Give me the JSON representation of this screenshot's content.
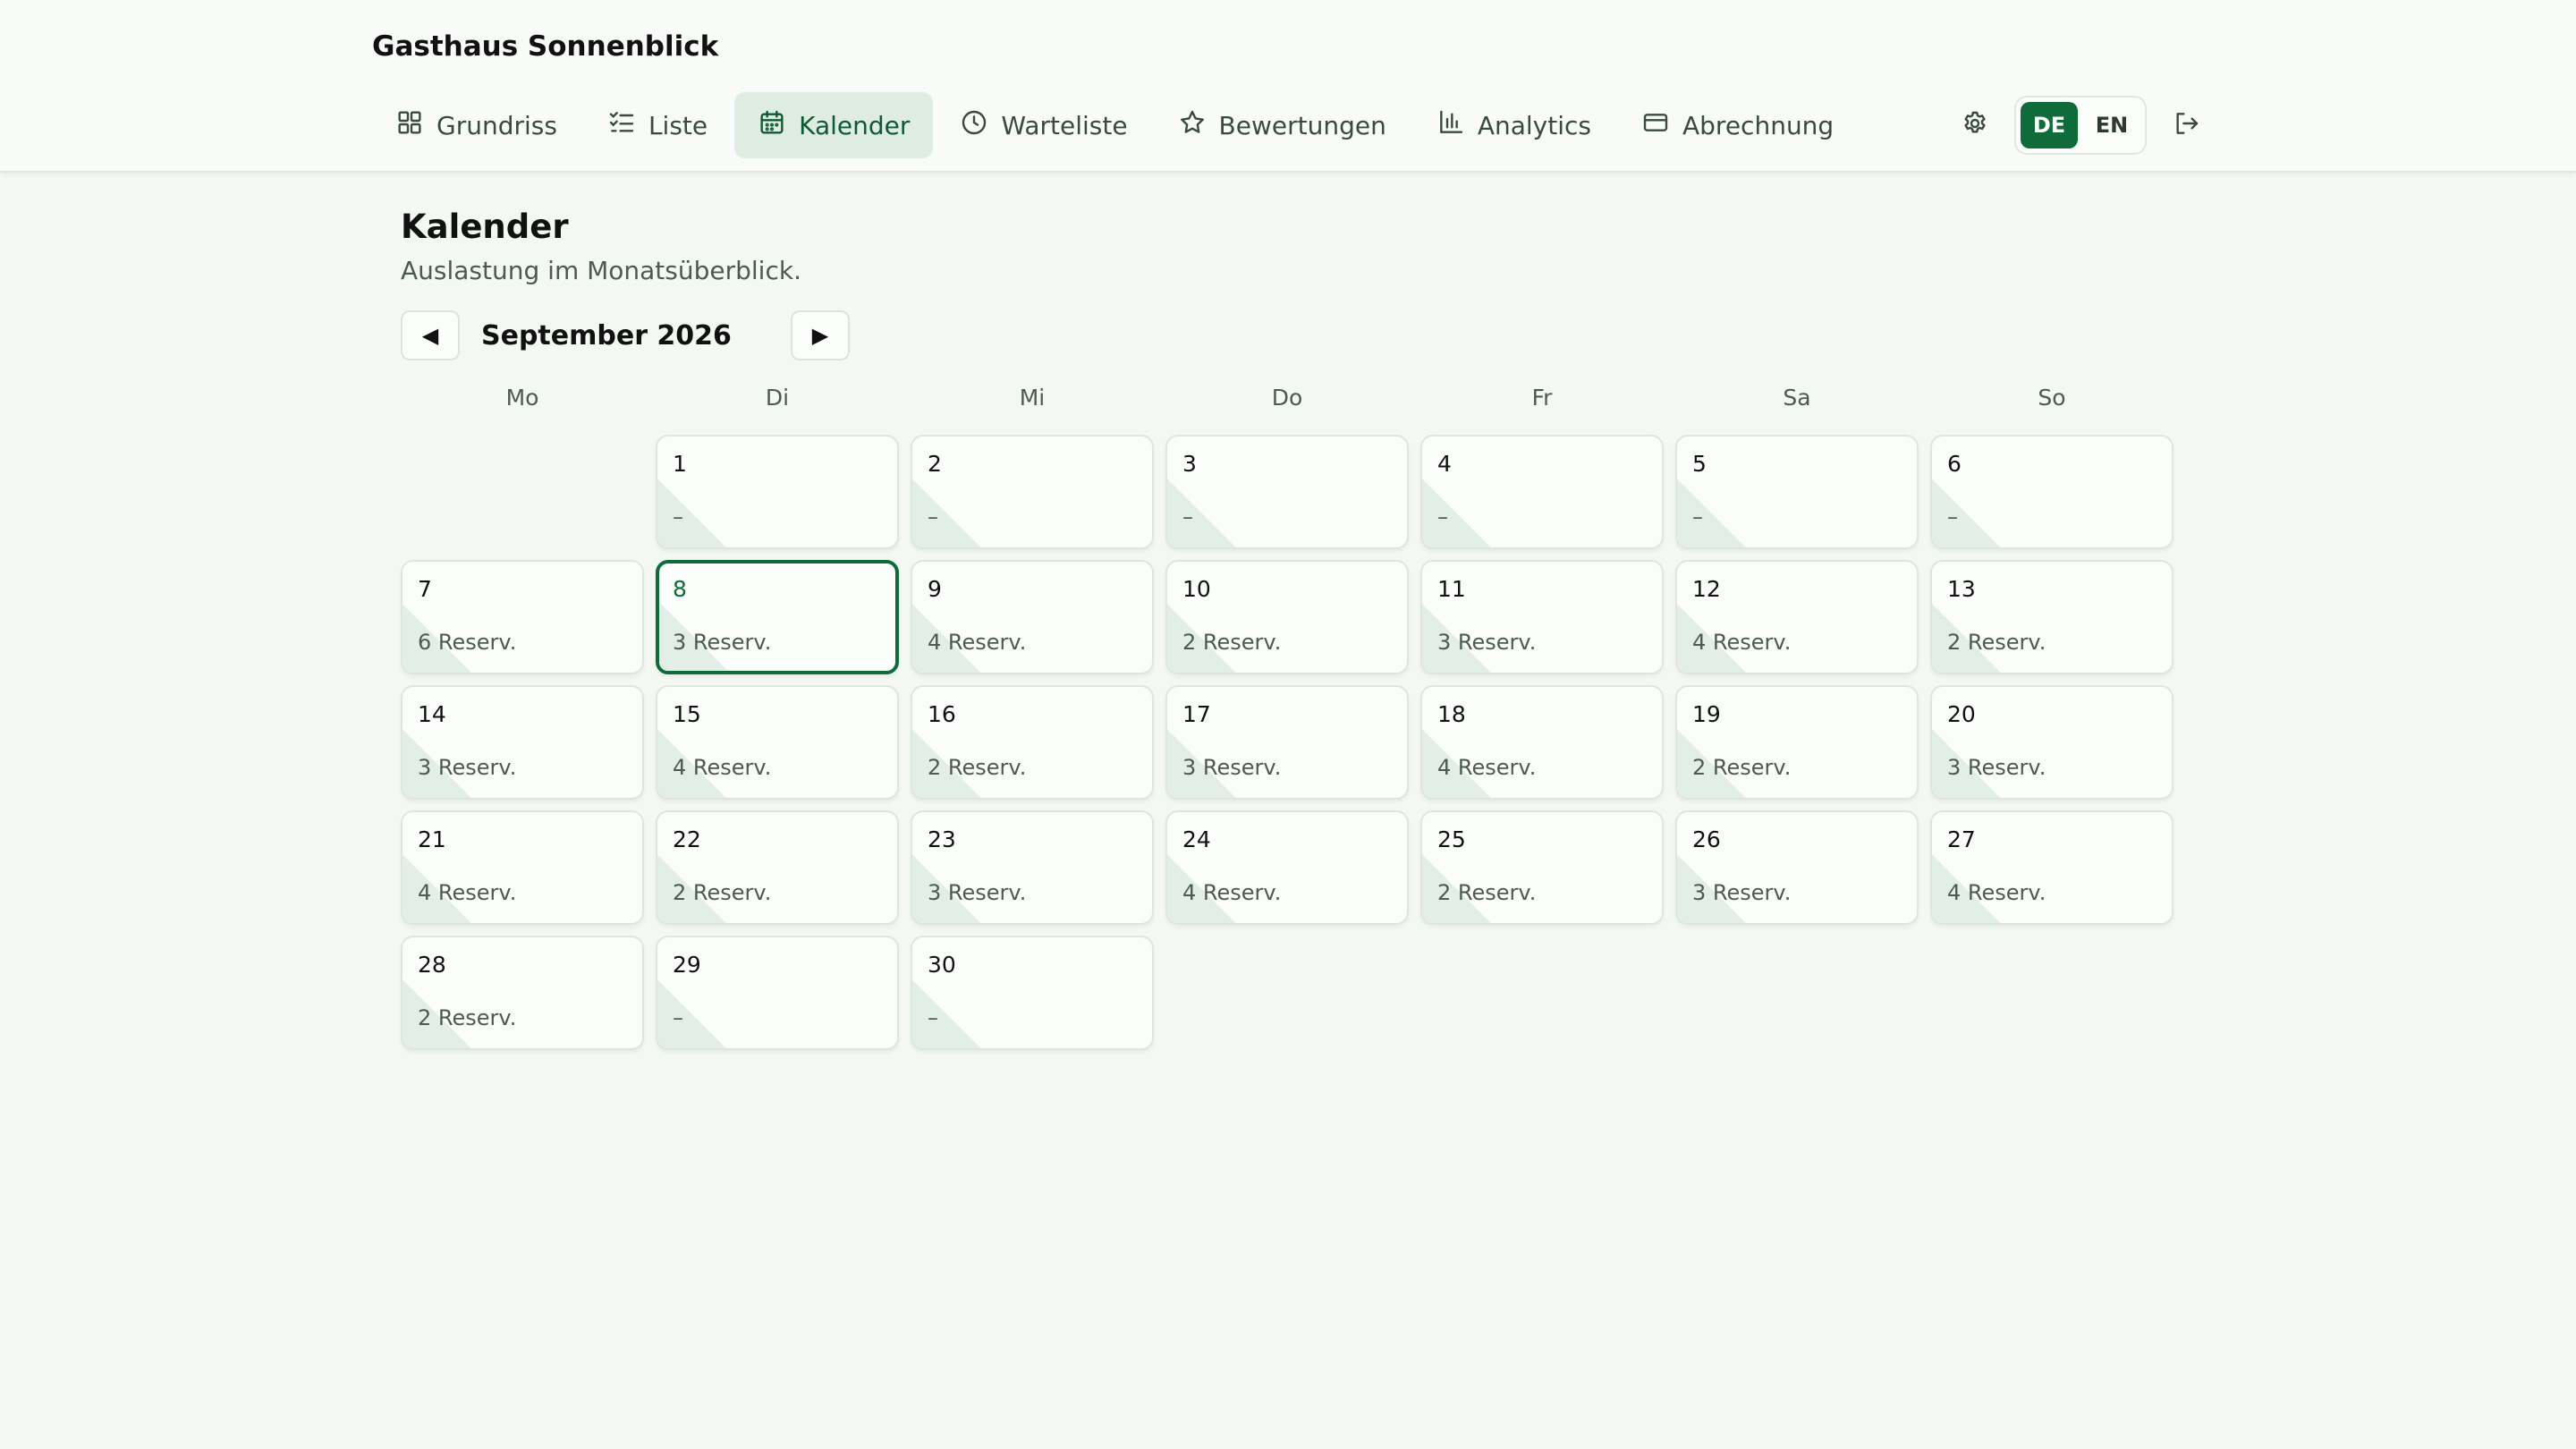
{
  "app": {
    "name": "Gasthaus Sonnenblick"
  },
  "nav": [
    {
      "label": "Grundriss",
      "icon": "grid-icon",
      "active": false
    },
    {
      "label": "Liste",
      "icon": "checklist-icon",
      "active": false
    },
    {
      "label": "Kalender",
      "icon": "calendar-icon",
      "active": true
    },
    {
      "label": "Warteliste",
      "icon": "clock-icon",
      "active": false
    },
    {
      "label": "Bewertungen",
      "icon": "star-icon",
      "active": false
    },
    {
      "label": "Analytics",
      "icon": "bar-chart-icon",
      "active": false
    },
    {
      "label": "Abrechnung",
      "icon": "credit-card-icon",
      "active": false
    }
  ],
  "tools": {
    "settings_icon": "gear-icon",
    "languages": [
      {
        "code": "DE",
        "active": true
      },
      {
        "code": "EN",
        "active": false
      }
    ],
    "logout_icon": "logout-icon"
  },
  "page": {
    "title": "Kalender",
    "subtitle": "Auslastung im Monatsüberblick."
  },
  "calendar": {
    "month_label": "September 2026",
    "prev_icon": "◀",
    "next_icon": "▶",
    "weekdays": [
      "Mo",
      "Di",
      "Mi",
      "Do",
      "Fr",
      "Sa",
      "So"
    ],
    "leading_blanks": 1,
    "selected_day": 8,
    "days": [
      {
        "day": "1",
        "res": "–"
      },
      {
        "day": "2",
        "res": "–"
      },
      {
        "day": "3",
        "res": "–"
      },
      {
        "day": "4",
        "res": "–"
      },
      {
        "day": "5",
        "res": "–"
      },
      {
        "day": "6",
        "res": "–"
      },
      {
        "day": "7",
        "res": "6 Reserv."
      },
      {
        "day": "8",
        "res": "3 Reserv."
      },
      {
        "day": "9",
        "res": "4 Reserv."
      },
      {
        "day": "10",
        "res": "2 Reserv."
      },
      {
        "day": "11",
        "res": "3 Reserv."
      },
      {
        "day": "12",
        "res": "4 Reserv."
      },
      {
        "day": "13",
        "res": "2 Reserv."
      },
      {
        "day": "14",
        "res": "3 Reserv."
      },
      {
        "day": "15",
        "res": "4 Reserv."
      },
      {
        "day": "16",
        "res": "2 Reserv."
      },
      {
        "day": "17",
        "res": "3 Reserv."
      },
      {
        "day": "18",
        "res": "4 Reserv."
      },
      {
        "day": "19",
        "res": "2 Reserv."
      },
      {
        "day": "20",
        "res": "3 Reserv."
      },
      {
        "day": "21",
        "res": "4 Reserv."
      },
      {
        "day": "22",
        "res": "2 Reserv."
      },
      {
        "day": "23",
        "res": "3 Reserv."
      },
      {
        "day": "24",
        "res": "4 Reserv."
      },
      {
        "day": "25",
        "res": "2 Reserv."
      },
      {
        "day": "26",
        "res": "3 Reserv."
      },
      {
        "day": "27",
        "res": "4 Reserv."
      },
      {
        "day": "28",
        "res": "2 Reserv."
      },
      {
        "day": "29",
        "res": "–"
      },
      {
        "day": "30",
        "res": "–"
      }
    ]
  },
  "colors": {
    "accent": "#0f6b3a",
    "accent_soft": "#dfece2",
    "background": "#f4f8f3"
  }
}
